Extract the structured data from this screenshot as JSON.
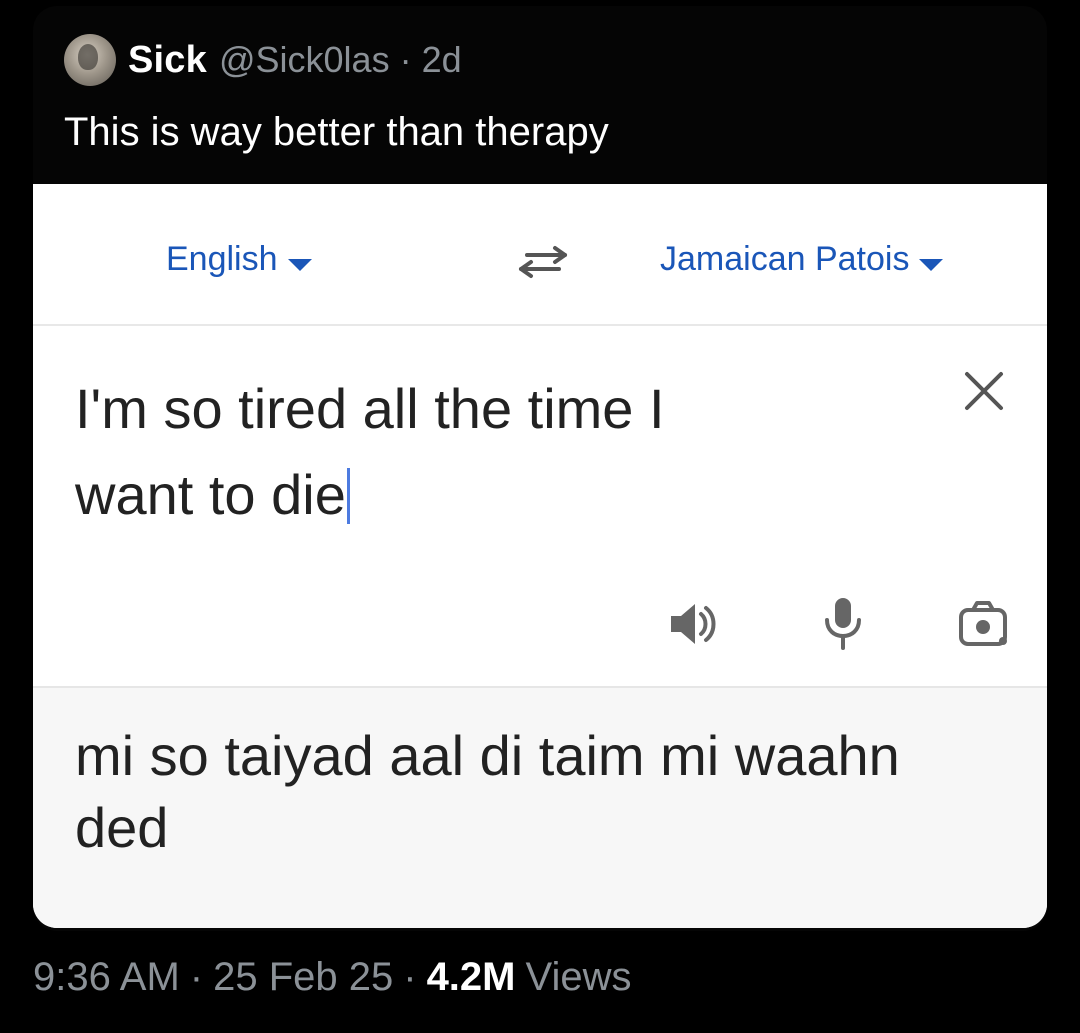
{
  "tweet": {
    "display_name": "Sick",
    "handle": "@Sick0las",
    "separator": "·",
    "time_ago": "2d",
    "text": "This is way better than therapy"
  },
  "translate": {
    "source_language": "English",
    "target_language": "Jamaican Patois",
    "input_line1": "I'm so tired all the time I",
    "input_line2": "want to die",
    "output_line1": "mi so taiyad aal di taim mi waahn",
    "output_line2": "ded",
    "icons": {
      "swap": "swap-icon",
      "clear": "close-icon",
      "speaker": "speaker-icon",
      "microphone": "microphone-icon",
      "camera": "camera-icon"
    },
    "colors": {
      "accent_blue": "#1a56b8",
      "text": "#222222",
      "output_bg": "#f7f7f7"
    }
  },
  "meta": {
    "time": "9:36 AM",
    "separator": "·",
    "date": "25 Feb 25",
    "views_count": "4.2M",
    "views_label": "Views"
  }
}
